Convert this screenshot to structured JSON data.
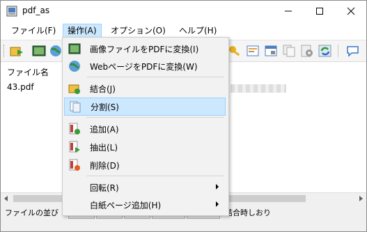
{
  "window": {
    "title": "pdf_as"
  },
  "menubar": [
    {
      "label": "ファイル(F)"
    },
    {
      "label": "操作(A)"
    },
    {
      "label": "オプション(O)"
    },
    {
      "label": "ヘルプ(H)"
    }
  ],
  "list": {
    "header": "ファイル名",
    "rows": [
      "43.pdf"
    ]
  },
  "status": {
    "left_text": "ファイルの並び",
    "right_text": "結合時しおり"
  },
  "dropdown": {
    "items": [
      {
        "label": "画像ファイルをPDFに変換(I)"
      },
      {
        "label": "WebページをPDFに変換(W)"
      },
      {
        "label": "結合(J)"
      },
      {
        "label": "分割(S)"
      },
      {
        "label": "追加(A)"
      },
      {
        "label": "抽出(L)"
      },
      {
        "label": "削除(D)"
      },
      {
        "label": "回転(R)"
      },
      {
        "label": "白紙ページ追加(H)"
      }
    ]
  },
  "colors": {
    "highlight": "#cce8ff",
    "highlight_border": "#99d1ff"
  }
}
